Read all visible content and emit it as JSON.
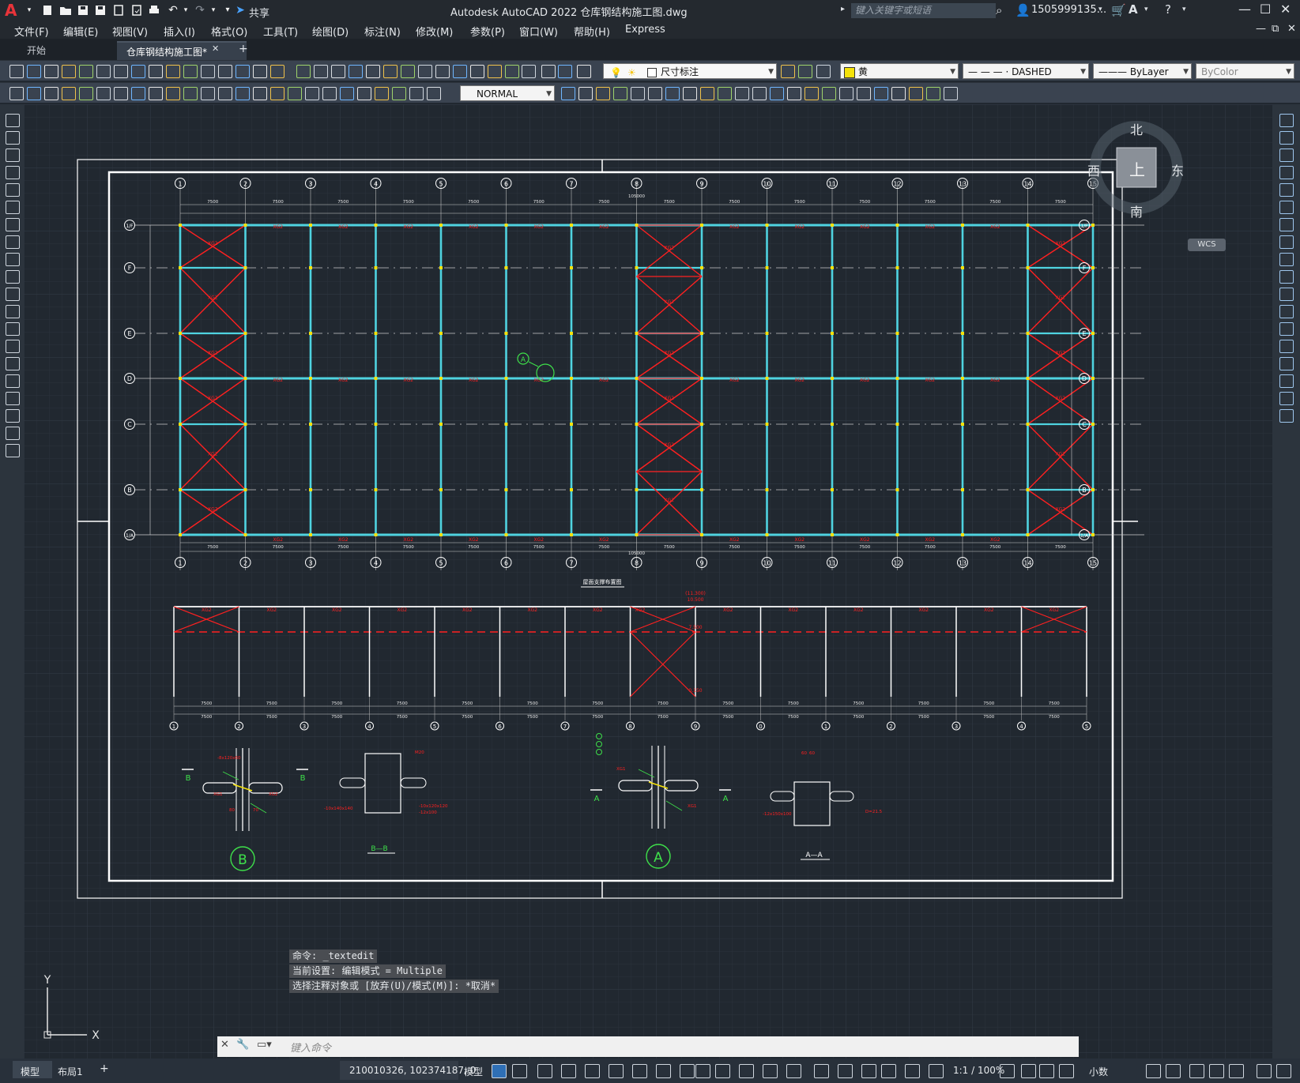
{
  "app": {
    "title": "Autodesk AutoCAD 2022    仓库钢结构施工图.dwg",
    "logo_letter": "A",
    "share_label": "共享",
    "search_placeholder": "键入关键字或短语",
    "user_name": "1505999135..."
  },
  "menu": [
    "文件(F)",
    "编辑(E)",
    "视图(V)",
    "插入(I)",
    "格式(O)",
    "工具(T)",
    "绘图(D)",
    "标注(N)",
    "修改(M)",
    "参数(P)",
    "窗口(W)",
    "帮助(H)",
    "Express"
  ],
  "tabs": {
    "start": "开始",
    "active": "仓库钢结构施工图*",
    "close": "✕",
    "add": "+"
  },
  "toolbar1": {
    "dimstyle": "尺寸标注",
    "color": "黄",
    "linetype": "— — — · DASHED",
    "lineweight": "——— ByLayer",
    "plotstyle": "ByColor"
  },
  "toolbar2": {
    "textstyle": "NORMAL"
  },
  "viewcube": {
    "north": "北",
    "south": "南",
    "east": "东",
    "west": "西",
    "face": "上",
    "wcs": "WCS"
  },
  "drawing": {
    "grid_numbers": [
      "1",
      "2",
      "3",
      "4",
      "5",
      "6",
      "7",
      "8",
      "9",
      "10",
      "11",
      "12",
      "13",
      "14",
      "15"
    ],
    "grid_letters_left": [
      "1/F",
      "F",
      "E",
      "D",
      "C",
      "B",
      "1/A"
    ],
    "dim_span": "7500",
    "overall_dim": "105000",
    "brace_label": "XG2",
    "plan_title": "屋面支撑布置图",
    "elev_top": "(11.300)",
    "elev_mid": "10.500",
    "elev_7": "7.500",
    "elev_low": "0.150",
    "callout_A": "A",
    "callout_B": "B",
    "section_BB": "B—B",
    "section_AA": "A—A",
    "detail_labels": [
      "-8x120x60",
      "XG1",
      "XG2",
      "M20",
      "-10x140x140",
      "-10x120x120",
      "-12x100",
      "D=21.5",
      "-12x150x100",
      "60",
      "80",
      "70"
    ]
  },
  "ucs": {
    "x": "X",
    "y": "Y"
  },
  "command": {
    "history": [
      "命令: _textedit",
      "当前设置: 编辑模式 = Multiple",
      "选择注释对象或 [放弃(U)/模式(M)]: *取消*"
    ],
    "prompt_placeholder": "键入命令"
  },
  "status": {
    "model_tab": "模型",
    "layout_tab": "布局1",
    "add_tab": "+",
    "coords": "210010326, 102374187, 0",
    "model_label": "模型",
    "scale": "1:1 / 100%",
    "units": "小数"
  },
  "colors": {
    "canvas": "#212830",
    "column": "#4fd3e0",
    "brace": "#ff2020",
    "frame": "#ffffff",
    "grid_bubble": "#ffffff",
    "detail_green": "#3ee04a",
    "yellow": "#f5e20a"
  }
}
